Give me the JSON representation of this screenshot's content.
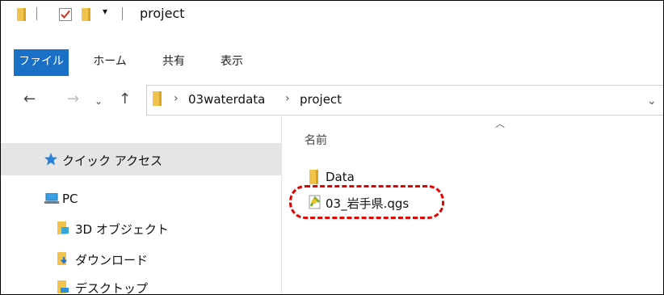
{
  "window": {
    "title": "project"
  },
  "ribbon": {
    "tabs": [
      {
        "label": "ファイル"
      },
      {
        "label": "ホーム"
      },
      {
        "label": "共有"
      },
      {
        "label": "表示"
      }
    ]
  },
  "address_bar": {
    "breadcrumbs": [
      "03waterdata",
      "project"
    ]
  },
  "nav_pane": {
    "items": [
      {
        "label": "クイック アクセス",
        "icon": "star-icon"
      },
      {
        "label": "PC",
        "icon": "pc-icon"
      },
      {
        "label": "3D オブジェクト",
        "icon": "folder-3d-icon"
      },
      {
        "label": "ダウンロード",
        "icon": "download-folder-icon"
      },
      {
        "label": "デスクトップ",
        "icon": "desktop-folder-icon"
      }
    ]
  },
  "content": {
    "column_header": "名前",
    "files": [
      {
        "name": "Data",
        "icon": "folder-icon"
      },
      {
        "name": "03_岩手県.qgs",
        "icon": "qgis-project-icon"
      }
    ]
  },
  "colors": {
    "file_tab": "#1a6fc7",
    "folder": "#f2c34a",
    "highlight": "#e00000",
    "quick_access_bg": "#e5e5e5"
  }
}
